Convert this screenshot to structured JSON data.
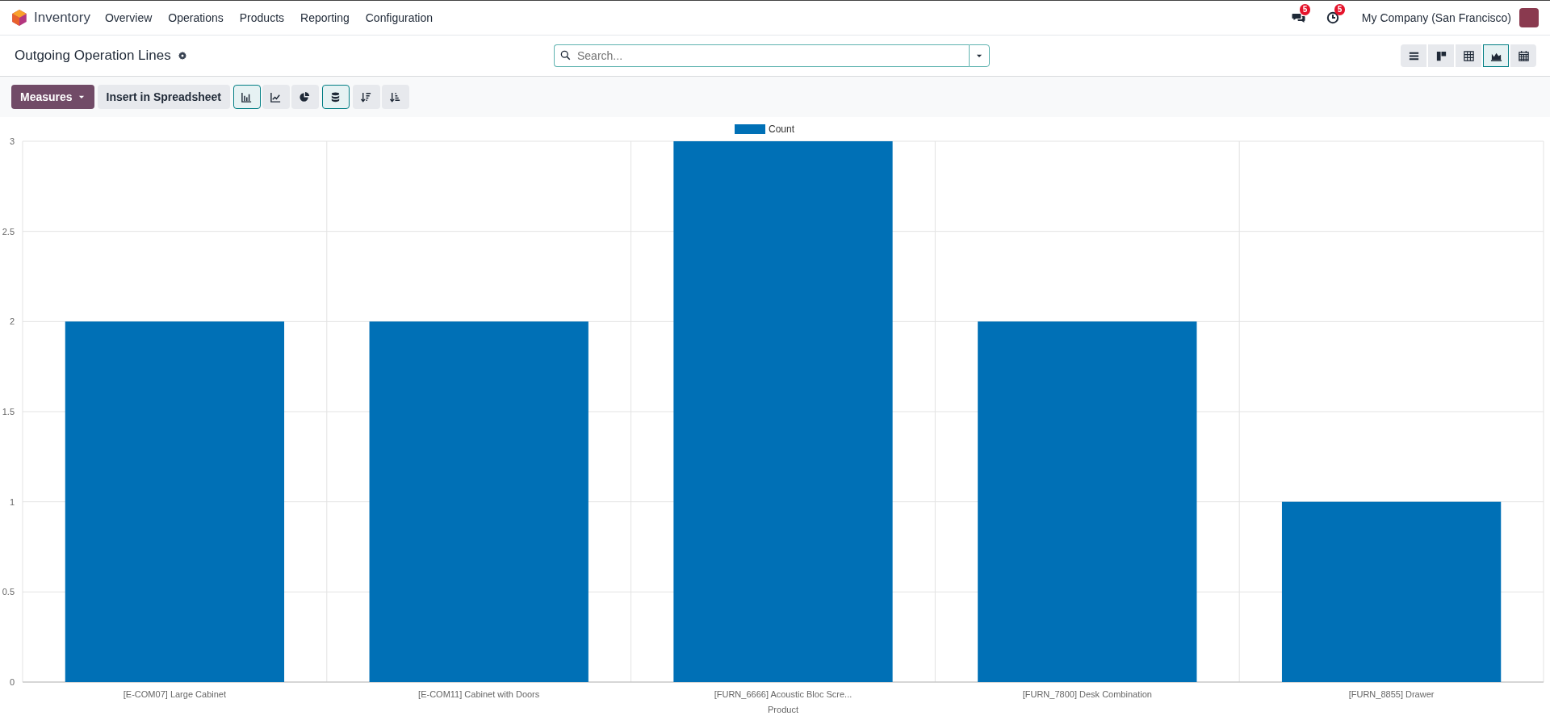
{
  "navbar": {
    "app_name": "Inventory",
    "menu": [
      "Overview",
      "Operations",
      "Products",
      "Reporting",
      "Configuration"
    ],
    "messages_badge": "5",
    "activities_badge": "5",
    "company": "My Company (San Francisco)"
  },
  "control_panel": {
    "title": "Outgoing Operation Lines",
    "search": {
      "placeholder": "Search..."
    },
    "views": [
      {
        "kind": "list",
        "selected": false
      },
      {
        "kind": "kanban",
        "selected": false
      },
      {
        "kind": "pivot",
        "selected": false
      },
      {
        "kind": "graph",
        "selected": true
      },
      {
        "kind": "calendar",
        "selected": false
      }
    ]
  },
  "graph_toolbar": {
    "measures": "Measures",
    "insert": "Insert in Spreadsheet",
    "chart_types": [
      {
        "kind": "bar",
        "selected": true
      },
      {
        "kind": "line",
        "selected": false
      },
      {
        "kind": "pie",
        "selected": false
      }
    ],
    "stacked": {
      "on": true
    }
  },
  "chart": {
    "chart_data": {
      "type": "bar",
      "xlabel": "Product",
      "grid": true,
      "categories": [
        "[E-COM07] Large Cabinet",
        "[E-COM11] Cabinet with Doors",
        "[FURN_6666] Acoustic Bloc Scre...",
        "[FURN_7800] Desk Combination",
        "[FURN_8855] Drawer"
      ],
      "series": [
        {
          "name": "Count",
          "color": "#0070b6",
          "values": [
            2,
            2,
            3,
            2,
            1
          ]
        }
      ],
      "ylim": [
        0,
        3
      ],
      "yticks": [
        0,
        0.5,
        1,
        1.5,
        2,
        2.5,
        3
      ]
    }
  }
}
